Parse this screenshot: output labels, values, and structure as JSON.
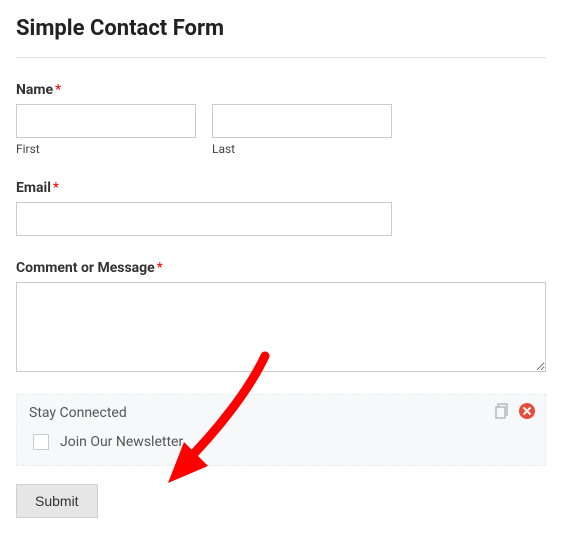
{
  "form": {
    "title": "Simple Contact Form",
    "name": {
      "label": "Name",
      "first_sublabel": "First",
      "last_sublabel": "Last"
    },
    "email": {
      "label": "Email"
    },
    "comment": {
      "label": "Comment or Message"
    },
    "stay_connected": {
      "title": "Stay Connected",
      "checkbox_label": "Join Our Newsletter"
    },
    "submit_label": "Submit"
  }
}
